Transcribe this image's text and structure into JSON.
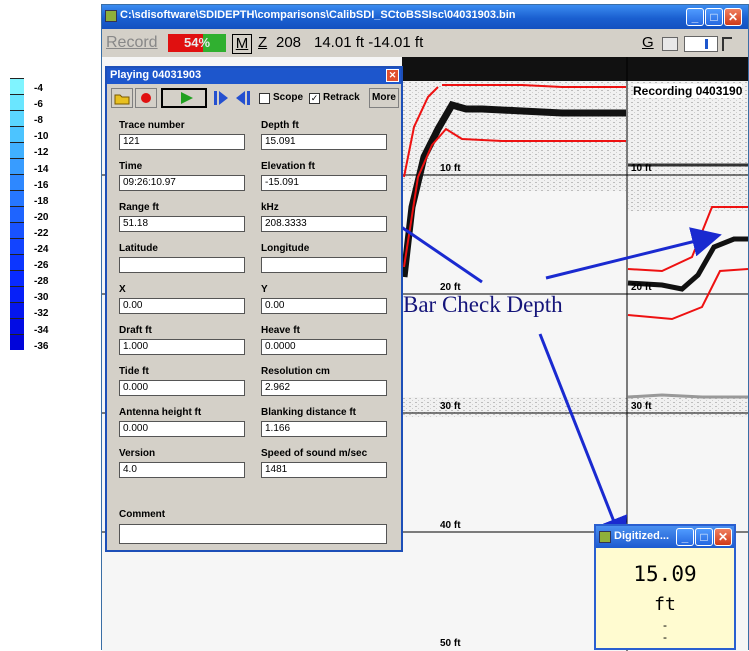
{
  "color_scale": {
    "ticks": [
      "-4",
      "-6",
      "-8",
      "-10",
      "-12",
      "-14",
      "-16",
      "-18",
      "-20",
      "-22",
      "-24",
      "-26",
      "-28",
      "-30",
      "-32",
      "-34",
      "-36"
    ],
    "colors": [
      "#80f4ff",
      "#6ae6ff",
      "#5ad6ff",
      "#4cc4ff",
      "#40b0ff",
      "#389cff",
      "#2e88ff",
      "#2676ff",
      "#1e64ff",
      "#1852ff",
      "#1244ff",
      "#0c36ff",
      "#082aff",
      "#0620f8",
      "#0416ee",
      "#020ce4",
      "#0004da"
    ]
  },
  "main_window": {
    "title": "C:\\sdisoftware\\SDIDEPTH\\comparisons\\CalibSDI_SCtoBSSIsc\\04031903.bin",
    "toolbar": {
      "record_label": "Record",
      "percent": "54%",
      "m_label": "M",
      "z_label": "Z",
      "value_208": "208",
      "range_text": "14.01 ft -14.01 ft",
      "g_label": "G"
    },
    "plot": {
      "depth_labels": [
        "10 ft",
        "20 ft",
        "30 ft",
        "40 ft",
        "50 ft"
      ],
      "recording_label": "Recording 0403190"
    }
  },
  "playing_dialog": {
    "title": "Playing 04031903",
    "scope_label": "Scope",
    "retrack_label": "Retrack",
    "more_label": "More",
    "fields": [
      {
        "label": "Trace number",
        "value": "121"
      },
      {
        "label": "Depth ft",
        "value": "15.091"
      },
      {
        "label": "Time",
        "value": "09:26:10.97"
      },
      {
        "label": "Elevation ft",
        "value": "-15.091"
      },
      {
        "label": "Range ft",
        "value": "51.18"
      },
      {
        "label": "kHz",
        "value": "208.3333"
      },
      {
        "label": "Latitude",
        "value": ""
      },
      {
        "label": "Longitude",
        "value": ""
      },
      {
        "label": "X",
        "value": "0.00"
      },
      {
        "label": "Y",
        "value": "0.00"
      },
      {
        "label": "Draft ft",
        "value": "1.000"
      },
      {
        "label": "Heave ft",
        "value": "0.0000"
      },
      {
        "label": "Tide ft",
        "value": "0.000"
      },
      {
        "label": "Resolution cm",
        "value": "2.962"
      },
      {
        "label": "Antenna height ft",
        "value": "0.000"
      },
      {
        "label": "Blanking distance ft",
        "value": "1.166"
      },
      {
        "label": "Version",
        "value": "4.0"
      },
      {
        "label": "Speed of sound m/sec",
        "value": "1481"
      }
    ],
    "comment_label": "Comment",
    "comment_value": ""
  },
  "annotation": "Bar Check Depth",
  "digitized_window": {
    "title": "Digitized...",
    "value": "15.09",
    "unit": "ft",
    "dash1": "-",
    "dash2": "-"
  }
}
